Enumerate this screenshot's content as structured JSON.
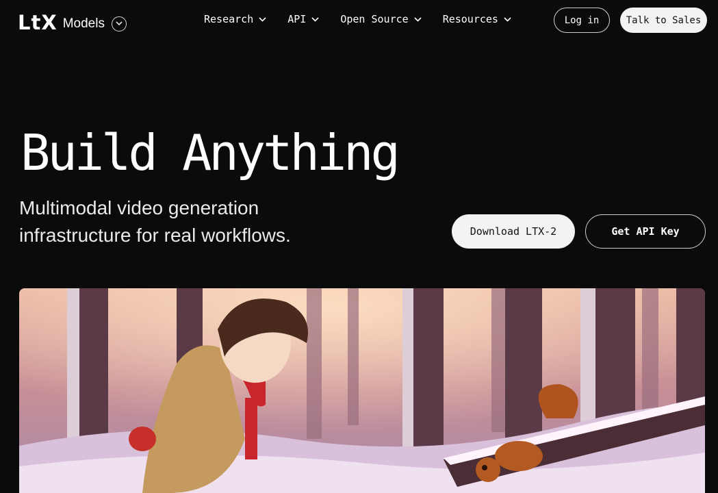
{
  "brand": {
    "mark": "LtX",
    "name": "Models"
  },
  "nav": {
    "items": [
      {
        "label": "Research"
      },
      {
        "label": "API"
      },
      {
        "label": "Open Source"
      },
      {
        "label": "Resources"
      }
    ],
    "login_label": "Log in",
    "sales_label": "Talk to Sales"
  },
  "hero": {
    "title": "Build Anything",
    "subtitle": "Multimodal video generation infrastructure for real workflows.",
    "download_label": "Download LTX-2",
    "api_label": "Get API Key"
  },
  "icons": {
    "dropdown": "chevron-down-icon",
    "brand_menu": "chevron-down-icon"
  },
  "colors": {
    "background": "#0c0b0b",
    "text": "#ffffff",
    "button_light": "#f3f3f3"
  }
}
